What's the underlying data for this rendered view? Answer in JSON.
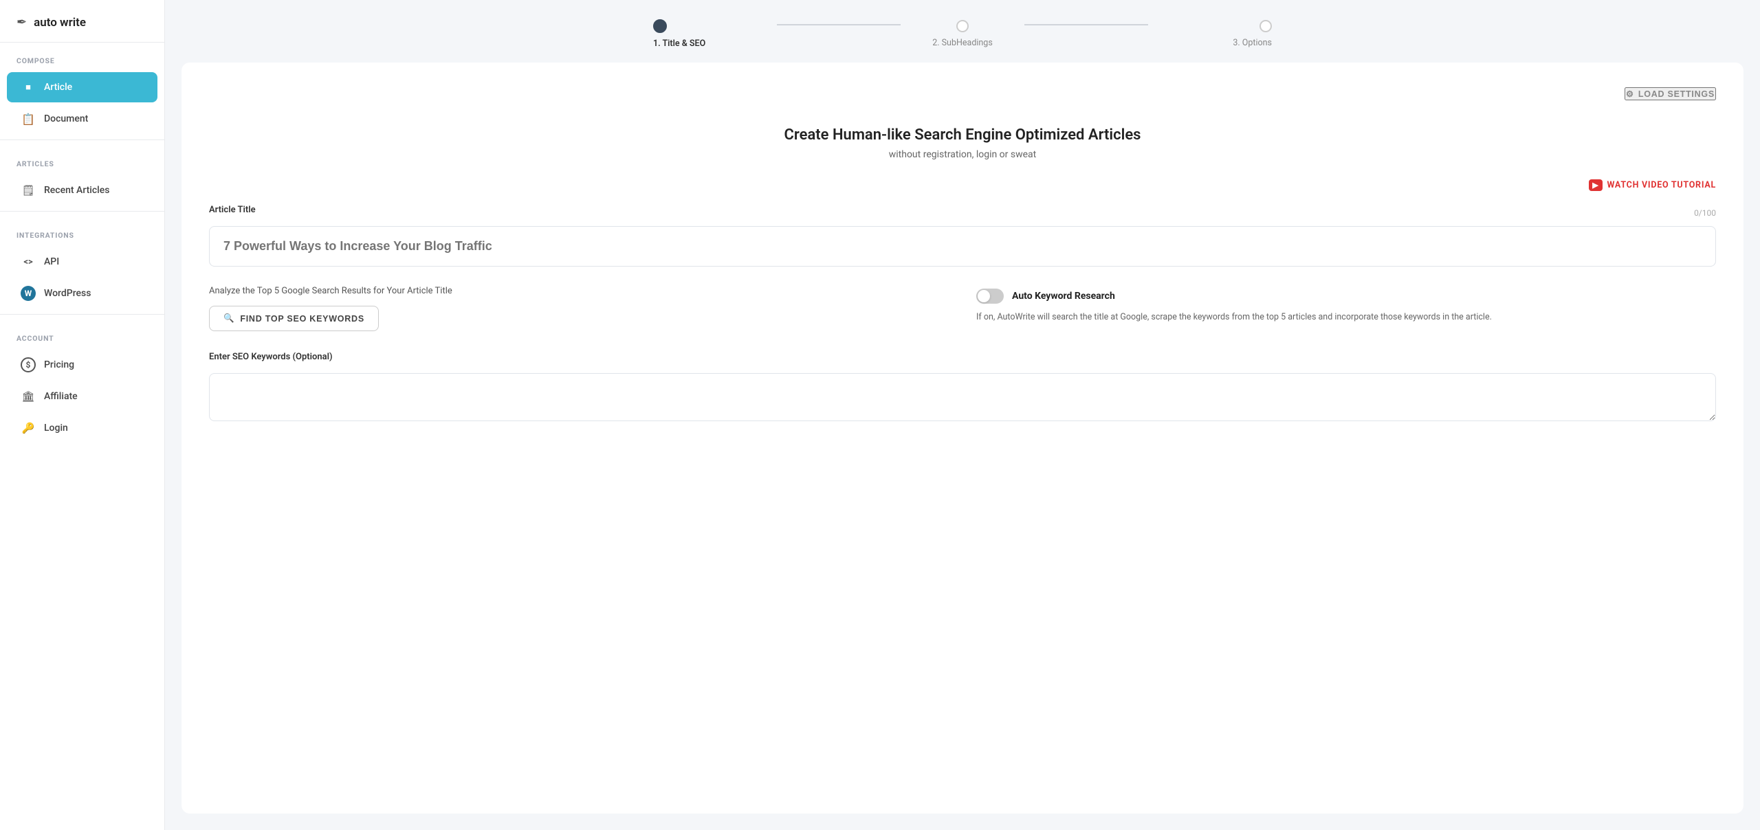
{
  "app": {
    "logo_icon": "✒",
    "title": "auto write"
  },
  "sidebar": {
    "sections": [
      {
        "label": "COMPOSE",
        "items": [
          {
            "id": "article",
            "label": "Article",
            "icon": "⬛",
            "active": true
          },
          {
            "id": "document",
            "label": "Document",
            "icon": "📄",
            "active": false
          }
        ]
      },
      {
        "label": "ARTICLES",
        "items": [
          {
            "id": "recent-articles",
            "label": "Recent Articles",
            "icon": "🗒",
            "active": false
          }
        ]
      },
      {
        "label": "INTEGRATIONS",
        "items": [
          {
            "id": "api",
            "label": "API",
            "icon": "<>",
            "active": false
          },
          {
            "id": "wordpress",
            "label": "WordPress",
            "icon": "W",
            "active": false
          }
        ]
      },
      {
        "label": "ACCOUNT",
        "items": [
          {
            "id": "pricing",
            "label": "Pricing",
            "icon": "$",
            "active": false
          },
          {
            "id": "affiliate",
            "label": "Affiliate",
            "icon": "🏛",
            "active": false
          },
          {
            "id": "login",
            "label": "Login",
            "icon": "🔑",
            "active": false
          }
        ]
      }
    ]
  },
  "stepper": {
    "steps": [
      {
        "label": "1. Title & SEO",
        "active": true
      },
      {
        "label": "2. SubHeadings",
        "active": false
      },
      {
        "label": "3. Options",
        "active": false
      }
    ]
  },
  "load_settings": {
    "icon": "⚙",
    "label": "LOAD SETTINGS"
  },
  "card": {
    "title": "Create Human-like Search Engine Optimized Articles",
    "subtitle": "without registration, login or sweat"
  },
  "watch_tutorial": {
    "label": "WATCH VIDEO TUTORIAL"
  },
  "article_title_field": {
    "label": "Article Title",
    "char_count": "0/100",
    "placeholder": "7 Powerful Ways to Increase Your Blog Traffic"
  },
  "seo_section": {
    "analyze_text": "Analyze the Top 5 Google Search Results for Your Article Title",
    "find_btn_label": "FIND TOP SEO KEYWORDS",
    "auto_keyword": {
      "title": "Auto Keyword Research",
      "description": "If on, AutoWrite will search the title at Google, scrape the keywords from the top 5 articles and incorporate those keywords in the article."
    }
  },
  "seo_keywords_field": {
    "label": "Enter SEO Keywords (Optional)",
    "placeholder": ""
  }
}
